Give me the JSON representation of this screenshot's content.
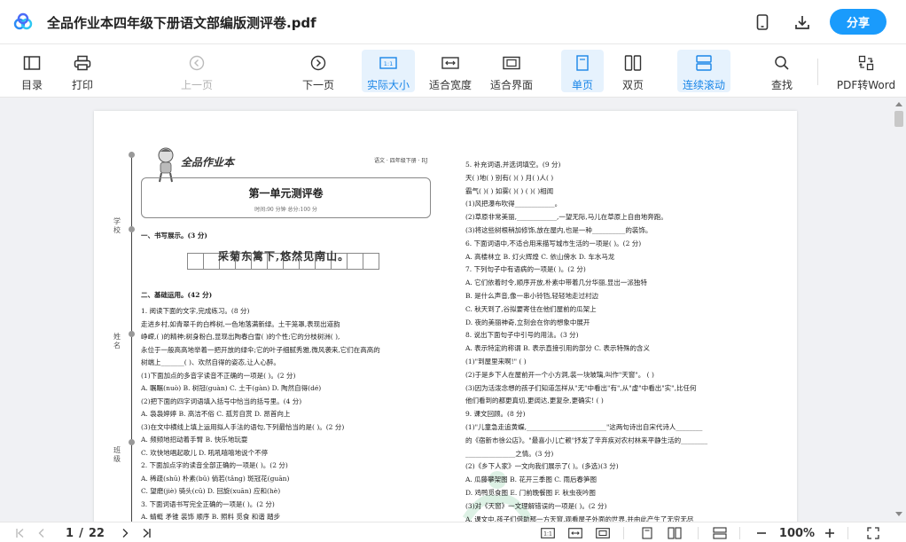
{
  "header": {
    "title": "全品作业本四年级下册语文部编版测评卷.pdf",
    "share_label": "分享",
    "brand_color": "#1a9bfc"
  },
  "toolbar": {
    "items": [
      {
        "label": "目录",
        "icon": "outline-icon"
      },
      {
        "label": "打印",
        "icon": "print-icon"
      },
      {
        "label": "上一页",
        "icon": "prev-page-icon",
        "disabled": true
      },
      {
        "label": "下一页",
        "icon": "next-page-icon"
      },
      {
        "label": "实际大小",
        "icon": "actual-size-icon",
        "active": true
      },
      {
        "label": "适合宽度",
        "icon": "fit-width-icon"
      },
      {
        "label": "适合界面",
        "icon": "fit-page-icon"
      },
      {
        "label": "单页",
        "icon": "single-page-icon",
        "active": true
      },
      {
        "label": "双页",
        "icon": "double-page-icon"
      },
      {
        "label": "连续滚动",
        "icon": "continuous-scroll-icon",
        "active": true
      },
      {
        "label": "查找",
        "icon": "search-icon"
      },
      {
        "label": "PDF转Word",
        "icon": "pdf-to-word-icon"
      }
    ],
    "page_current": "1",
    "page_sep": "/",
    "page_total": "22"
  },
  "document": {
    "brand": "全品作业本",
    "grade": "语文 · 四年级下册 · RJ",
    "title": "第一单元测评卷",
    "subtitle": "时间:90 分钟      总分:100 分",
    "margin_labels": [
      "学校",
      "姓名",
      "班级"
    ],
    "left": [
      {
        "text": "一、书写展示。(3 分)",
        "bold": true
      },
      {
        "text": "采菊东篱下,悠然见南山。",
        "poem": true
      },
      {
        "text": "二、基础运用。(42 分)",
        "bold": true
      },
      {
        "text": "1. 阅读下面的文字,完成练习。(8 分)"
      },
      {
        "text": "走进乡村,如青翠千的白桦树,一色地落满新绿。土干笼罩,表现出道韵"
      },
      {
        "text": "峥嵘,(     )的精神;树身粉白,显现出陶春白雪(     )的个性;它的分枝树洲(     ),"
      },
      {
        "text": "永位于一般高高地举着一把开放的绿伞;它的叶子细腻秀雅,微风袭来,它们在高高的"
      },
      {
        "text": "树端上_______(     )、欢然自得的姿态,让人心醉。"
      },
      {
        "text": "(1)下面加点的多音字读音不正确的一项是(     )。(2 分)"
      },
      {
        "text": "A. 瞩瞩(nuò)     B. 树冠(guàn)     C. 土干(gàn)     D. 陶然自得(dé)"
      },
      {
        "text": "(2)把下面的四字词语填入括号中恰当的括号里。(4 分)"
      },
      {
        "text": "A. 袅袅婷婷      B. 高洁不俗      C. 孤芳自赏      D. 昂首向上"
      },
      {
        "text": "(3)在文中横线上填上运用拟人手法的语句,下列最恰当的是(     )。(2 分)"
      },
      {
        "text": "A. 频频地招动着手臂              B. 快乐地玩耍"
      },
      {
        "text": "C. 欢快地唱起歌儿                D. 吼吼嘻嘻地说个不停"
      },
      {
        "text": "2. 下面加点字的读音全部正确的一项是(     )。(2 分)"
      },
      {
        "text": "A. 稀疏(shū)      朴素(bǔ)      倘若(tǎng)      斑冠花(guān)"
      },
      {
        "text": "C. 望磨(jiè)      骑头(cū)      D. 回旋(xuān)      应和(hè)"
      },
      {
        "text": "3. 下面词语书写完全正确的一项是(     )。(2 分)"
      },
      {
        "text": "A. 蜻蜓      矛锥      装饰      顺序      B. 照料      觅食      和谐      踏步"
      }
    ],
    "right": [
      {
        "text": "5. 补充词语,并选词填空。(9 分)"
      },
      {
        "text": "天(     )地(     )          别有(     )(     )          月(     )人(     )"
      },
      {
        "text": "霸气(     )(     )          如雾(     )(     )          (     )(     )相闻"
      },
      {
        "text": "(1)风把瀑布吹得____________。"
      },
      {
        "text": "(2)草原非常美丽,____________,一望无际,马儿在草原上自由地奔跑。"
      },
      {
        "text": "(3)将这些树根稍加修饰,放在屋内,也是一种__________的装饰。"
      },
      {
        "text": "6. 下面词语中,不适合用来描写城市生活的一项是(     )。(2 分)"
      },
      {
        "text": "A. 高楼林立          B. 灯火辉煌          C. 依山傍水          D. 车水马龙"
      },
      {
        "text": "7. 下列句子中有语病的一项是(     )。(2 分)"
      },
      {
        "text": "A. 它们依着时令,顺序开放,朴素中带着几分华丽,显出一派独特"
      },
      {
        "text": "B. 是什么声音,像一串小铃铛,轻轻地走过村边"
      },
      {
        "text": "C. 秋天到了,谷拟要寄住在他们屋前的瓜架上"
      },
      {
        "text": "D. 夜的美丽神奇,立刻会在你的想象中展开"
      },
      {
        "text": "8. 说出下面句子中引号的用法。(3 分)"
      },
      {
        "text": "A. 表示特定的称谓     B. 表示直接引用的部分     C. 表示特殊的含义"
      },
      {
        "text": "(1)\"到屋里来啊!\"                                                                (     )"
      },
      {
        "text": "(2)于是乡下人在屋前开一个小方洞,装一块玻璃,叫作\"天窗\"。                    (     )"
      },
      {
        "text": "(3)因为活泼念想的孩子们知道怎样从\"无\"中看出\"有\",从\"虚\"中看出\"实\",比任何"
      },
      {
        "text": "他们看到的都更真切,更阔达,更复杂,更确实!                                    (     )"
      },
      {
        "text": "9. 课文回顾。(8 分)"
      },
      {
        "text": "(1)\"儿童急走追黄蝶,________________________\"这两句诗出自宋代诗人________"
      },
      {
        "text": "的《宿新市徐公店》。\"最喜小儿亡赖\"抒发了辛弃疾对农村林来平静生活的________"
      },
      {
        "text": "_______________之情。(3 分)"
      },
      {
        "text": "(2)《乡下人家》一文向我们展示了(     )。(多选)(3 分)"
      },
      {
        "text": "A. 瓜藤攀架图          B. 花开三季图          C. 雨后春笋图"
      },
      {
        "text": "D. 鸡鸭觅食图          E. 门前晚餐图          F. 秋虫夜吟图"
      },
      {
        "text": "(3)对《天窗》一文理解错误的一项是(     )。(2 分)"
      },
      {
        "text": "A. 课文中,孩子们借助那一方天窗,观看屋子外面的世界,并由此产生了无穷无尽"
      }
    ]
  },
  "footer": {
    "page_current": "1",
    "page_sep": "/",
    "page_total": "22",
    "zoom": "100%"
  }
}
